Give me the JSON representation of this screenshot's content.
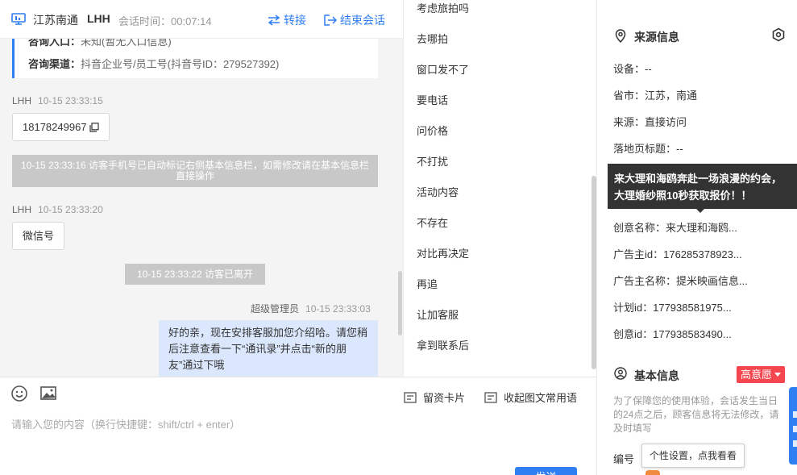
{
  "header": {
    "location": "江苏南通",
    "agent": "LHH",
    "timer": "会话时间：00:07:14",
    "transfer_label": "转接",
    "end_label": "结束会话"
  },
  "chat": {
    "card": {
      "entry_label": "咨询入口：",
      "entry_value": "未知(暂无入口信息)",
      "channel_label": "咨询渠道：",
      "channel_value": "抖音企业号/员工号(抖音号ID：279527392)"
    },
    "messages": [
      {
        "sender": "LHH",
        "time": "10-15 23:33:15",
        "text": "18178249967"
      },
      {
        "sender": "LHH",
        "time": "10-15 23:33:20",
        "text": "微信号"
      }
    ],
    "system": [
      "10-15 23:33:16 访客手机号已自动标记右侧基本信息栏，如需修改请在基本信息栏直接操作",
      "10-15 23:33:22 访客已离开"
    ],
    "mine": {
      "sender": "超级管理员",
      "time": "10-15 23:33:03",
      "text": "好的亲，现在安排客服加您介绍哈。请您稍后注意查看一下“通讯录”并点击“新的朋友”通过下哦"
    }
  },
  "composer": {
    "placeholder": "请输入您的内容（换行快捷键：shift/ctrl + enter）",
    "card_label": "留资卡片",
    "collapse_label": "收起图文常用语",
    "send_label": "发送"
  },
  "quick_replies": [
    "考虑旅拍吗",
    "去哪拍",
    "窗口发不了",
    "要电话",
    "问价格",
    "不打扰",
    "活动内容",
    "不存在",
    "对比再决定",
    "再追",
    "让加客服",
    "拿到联系后"
  ],
  "source": {
    "title": "来源信息",
    "fields": [
      "设备：--",
      "省市：江苏，南通",
      "来源：直接访问",
      "落地页标题：--",
      "创意名称：来大理和海鸥...",
      "广告主id：176285378923...",
      "广告主名称：提米映画信息...",
      "计划id：177938581975...",
      "创意id：177938583490..."
    ],
    "tooltip": "来大理和海鸥奔赴一场浪漫的约会，大理婚纱照10秒获取报价！！"
  },
  "basic": {
    "title": "基本信息",
    "intent": "高意愿",
    "note": "为了保障您的使用体验，会话发生当日的24点之后，顾客信息将无法修改，请及时填写",
    "id_label": "编号",
    "popover": "个性设置，点我看看"
  },
  "colors": {
    "accent": "#2f7ff3",
    "intent": "#f5454f",
    "my_bubble": "#dbe7fd",
    "system_bg": "#c8c8c8"
  }
}
